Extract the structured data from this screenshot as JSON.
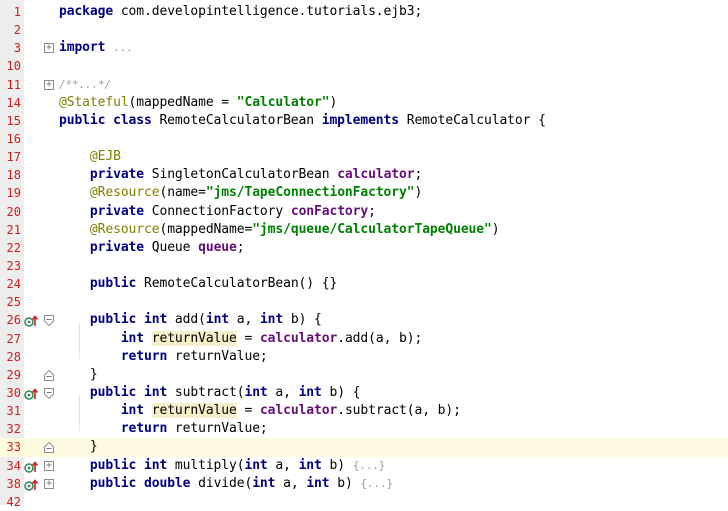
{
  "colors": {
    "line_number": "#cc1f1f",
    "keyword": "#000080",
    "string": "#008000",
    "annotation": "#808000",
    "field": "#660e7a",
    "folded_text": "#9a9a9a",
    "gutter_bg": "#eeeeee",
    "caret_line": "#fffbe0",
    "implement_marker": "#2e8b57"
  },
  "lines": [
    {
      "no": "1",
      "fold": "",
      "marker": "",
      "parts": [
        {
          "t": "package ",
          "c": "kw"
        },
        {
          "t": "com.developintelligence.tutorials.ejb3;",
          "c": ""
        }
      ]
    },
    {
      "no": "2",
      "fold": "",
      "marker": "",
      "parts": []
    },
    {
      "no": "3",
      "fold": "plus",
      "marker": "",
      "parts": [
        {
          "t": "import ",
          "c": "kw"
        },
        {
          "t": "...",
          "c": "folded"
        }
      ]
    },
    {
      "no": "10",
      "fold": "",
      "marker": "",
      "parts": []
    },
    {
      "no": "11",
      "fold": "plus",
      "marker": "",
      "parts": [
        {
          "t": "/**...*/",
          "c": "cmt"
        }
      ]
    },
    {
      "no": "14",
      "fold": "",
      "marker": "",
      "parts": [
        {
          "t": "@Stateful",
          "c": "ann"
        },
        {
          "t": "(mappedName = ",
          "c": ""
        },
        {
          "t": "\"Calculator\"",
          "c": "str"
        },
        {
          "t": ")",
          "c": ""
        }
      ]
    },
    {
      "no": "15",
      "fold": "",
      "marker": "",
      "parts": [
        {
          "t": "public class ",
          "c": "kw"
        },
        {
          "t": "RemoteCalculatorBean ",
          "c": ""
        },
        {
          "t": "implements ",
          "c": "kw"
        },
        {
          "t": "RemoteCalculator {",
          "c": ""
        }
      ]
    },
    {
      "no": "16",
      "fold": "",
      "marker": "",
      "parts": []
    },
    {
      "no": "17",
      "fold": "",
      "marker": "",
      "parts": [
        {
          "t": "    ",
          "c": ""
        },
        {
          "t": "@EJB",
          "c": "ann"
        }
      ]
    },
    {
      "no": "18",
      "fold": "",
      "marker": "",
      "parts": [
        {
          "t": "    ",
          "c": ""
        },
        {
          "t": "private ",
          "c": "kw"
        },
        {
          "t": "SingletonCalculatorBean ",
          "c": ""
        },
        {
          "t": "calculator",
          "c": "fld"
        },
        {
          "t": ";",
          "c": ""
        }
      ]
    },
    {
      "no": "19",
      "fold": "",
      "marker": "",
      "parts": [
        {
          "t": "    ",
          "c": ""
        },
        {
          "t": "@Resource",
          "c": "ann"
        },
        {
          "t": "(name=",
          "c": ""
        },
        {
          "t": "\"jms/TapeConnectionFactory\"",
          "c": "str"
        },
        {
          "t": ")",
          "c": ""
        }
      ]
    },
    {
      "no": "20",
      "fold": "",
      "marker": "",
      "parts": [
        {
          "t": "    ",
          "c": ""
        },
        {
          "t": "private ",
          "c": "kw"
        },
        {
          "t": "ConnectionFactory ",
          "c": ""
        },
        {
          "t": "conFactory",
          "c": "fld"
        },
        {
          "t": ";",
          "c": ""
        }
      ]
    },
    {
      "no": "21",
      "fold": "",
      "marker": "",
      "parts": [
        {
          "t": "    ",
          "c": ""
        },
        {
          "t": "@Resource",
          "c": "ann"
        },
        {
          "t": "(mappedName=",
          "c": ""
        },
        {
          "t": "\"jms/queue/CalculatorTapeQueue\"",
          "c": "str"
        },
        {
          "t": ")",
          "c": ""
        }
      ]
    },
    {
      "no": "22",
      "fold": "",
      "marker": "",
      "parts": [
        {
          "t": "    ",
          "c": ""
        },
        {
          "t": "private ",
          "c": "kw"
        },
        {
          "t": "Queue ",
          "c": ""
        },
        {
          "t": "queue",
          "c": "fld"
        },
        {
          "t": ";",
          "c": ""
        }
      ]
    },
    {
      "no": "23",
      "fold": "",
      "marker": "",
      "parts": []
    },
    {
      "no": "24",
      "fold": "",
      "marker": "",
      "parts": [
        {
          "t": "    ",
          "c": ""
        },
        {
          "t": "public ",
          "c": "kw"
        },
        {
          "t": "RemoteCalculatorBean() {}",
          "c": ""
        }
      ]
    },
    {
      "no": "25",
      "fold": "",
      "marker": "",
      "parts": []
    },
    {
      "no": "26",
      "fold": "open",
      "marker": "impl",
      "parts": [
        {
          "t": "    ",
          "c": ""
        },
        {
          "t": "public int ",
          "c": "kw"
        },
        {
          "t": "add(",
          "c": ""
        },
        {
          "t": "int ",
          "c": "kw"
        },
        {
          "t": "a, ",
          "c": ""
        },
        {
          "t": "int ",
          "c": "kw"
        },
        {
          "t": "b) {",
          "c": ""
        }
      ]
    },
    {
      "no": "27",
      "fold": "",
      "marker": "",
      "parts": [
        {
          "t": "        ",
          "c": ""
        },
        {
          "t": "int ",
          "c": "kw"
        },
        {
          "t": "returnValue",
          "c": "hl"
        },
        {
          "t": " = ",
          "c": ""
        },
        {
          "t": "calculator",
          "c": "fld"
        },
        {
          "t": ".add(a, b);",
          "c": ""
        }
      ]
    },
    {
      "no": "28",
      "fold": "",
      "marker": "",
      "parts": [
        {
          "t": "        ",
          "c": ""
        },
        {
          "t": "return ",
          "c": "kw"
        },
        {
          "t": "returnValue;",
          "c": ""
        }
      ]
    },
    {
      "no": "29",
      "fold": "close",
      "marker": "",
      "parts": [
        {
          "t": "    }",
          "c": ""
        }
      ]
    },
    {
      "no": "30",
      "fold": "open",
      "marker": "impl",
      "parts": [
        {
          "t": "    ",
          "c": ""
        },
        {
          "t": "public int ",
          "c": "kw"
        },
        {
          "t": "subtract(",
          "c": ""
        },
        {
          "t": "int ",
          "c": "kw"
        },
        {
          "t": "a, ",
          "c": ""
        },
        {
          "t": "int ",
          "c": "kw"
        },
        {
          "t": "b) {",
          "c": ""
        }
      ]
    },
    {
      "no": "31",
      "fold": "",
      "marker": "",
      "parts": [
        {
          "t": "        ",
          "c": ""
        },
        {
          "t": "int ",
          "c": "kw"
        },
        {
          "t": "returnValue",
          "c": "hl"
        },
        {
          "t": " = ",
          "c": ""
        },
        {
          "t": "calculator",
          "c": "fld"
        },
        {
          "t": ".subtract(a, b);",
          "c": ""
        }
      ]
    },
    {
      "no": "32",
      "fold": "",
      "marker": "",
      "parts": [
        {
          "t": "        ",
          "c": ""
        },
        {
          "t": "return ",
          "c": "kw"
        },
        {
          "t": "returnValue;",
          "c": ""
        }
      ]
    },
    {
      "no": "33",
      "fold": "close",
      "marker": "",
      "caret": true,
      "parts": [
        {
          "t": "    }",
          "c": ""
        }
      ]
    },
    {
      "no": "34",
      "fold": "plus",
      "marker": "impl",
      "parts": [
        {
          "t": "    ",
          "c": ""
        },
        {
          "t": "public int ",
          "c": "kw"
        },
        {
          "t": "multiply(",
          "c": ""
        },
        {
          "t": "int ",
          "c": "kw"
        },
        {
          "t": "a, ",
          "c": ""
        },
        {
          "t": "int ",
          "c": "kw"
        },
        {
          "t": "b) ",
          "c": ""
        },
        {
          "t": "{...}",
          "c": "folded"
        }
      ]
    },
    {
      "no": "38",
      "fold": "plus",
      "marker": "impl",
      "parts": [
        {
          "t": "    ",
          "c": ""
        },
        {
          "t": "public double ",
          "c": "kw"
        },
        {
          "t": "divide(",
          "c": ""
        },
        {
          "t": "int ",
          "c": "kw"
        },
        {
          "t": "a, ",
          "c": ""
        },
        {
          "t": "int ",
          "c": "kw"
        },
        {
          "t": "b) ",
          "c": ""
        },
        {
          "t": "{...}",
          "c": "folded"
        }
      ]
    },
    {
      "no": "42",
      "fold": "",
      "marker": "",
      "parts": []
    }
  ]
}
